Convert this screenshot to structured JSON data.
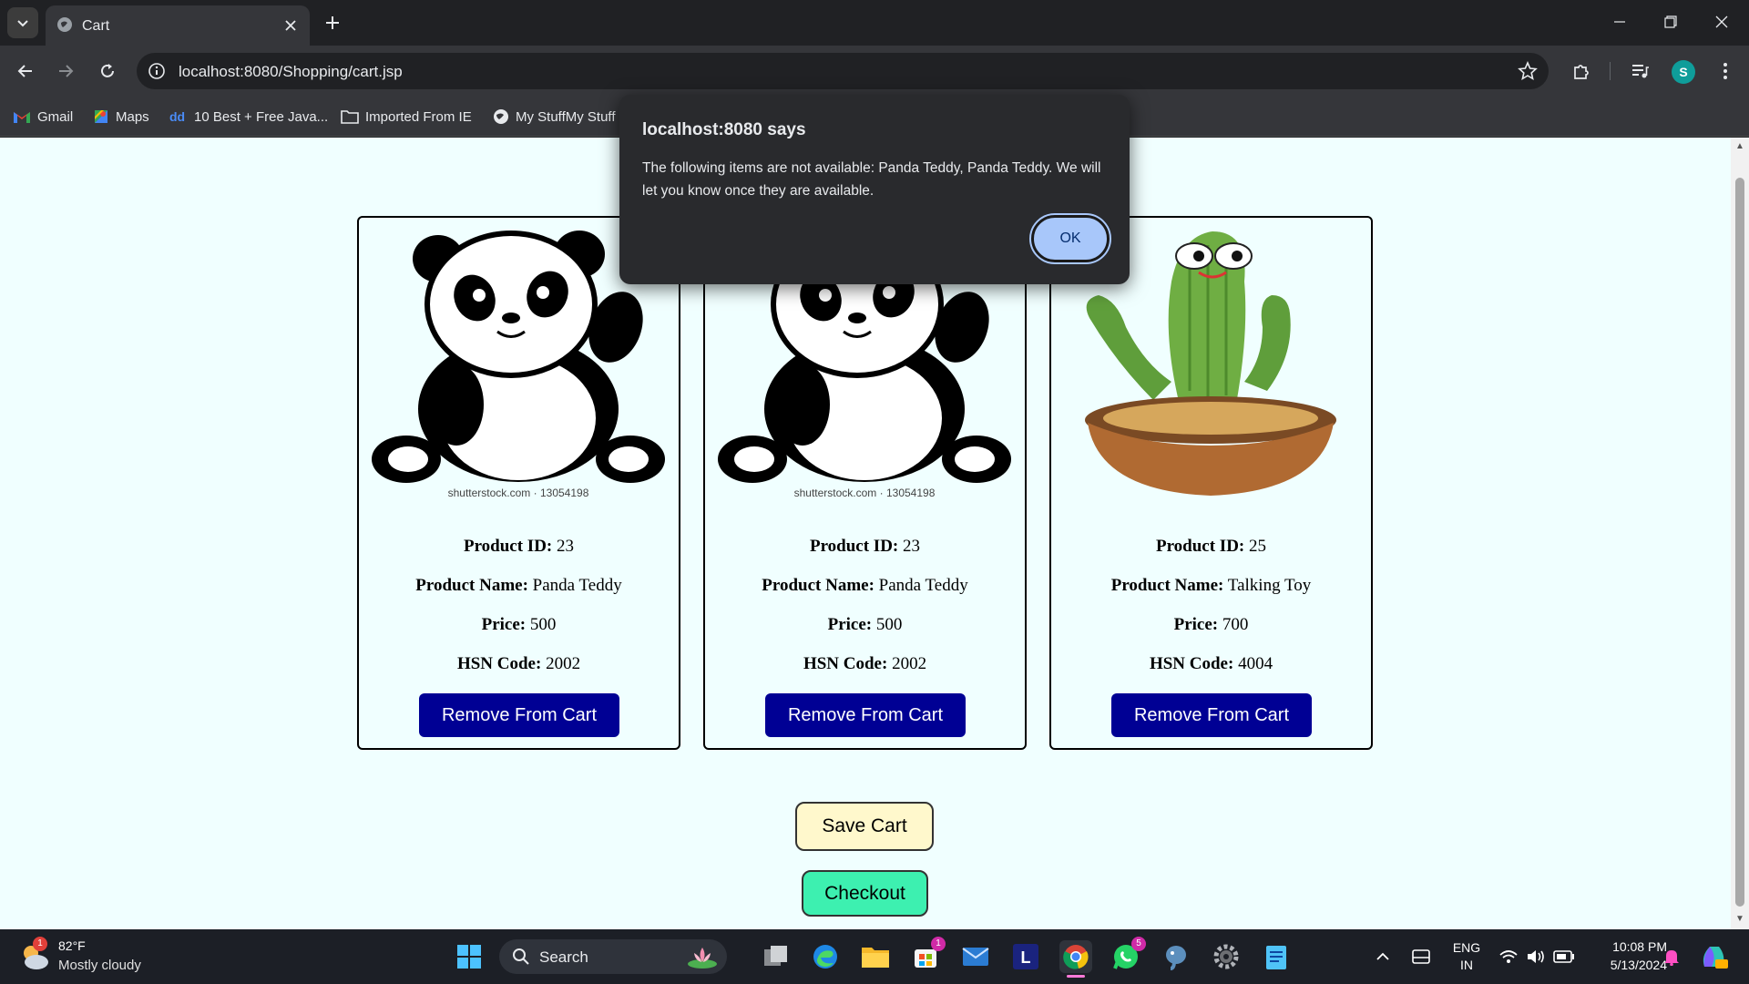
{
  "browser": {
    "tab_title": "Cart",
    "url": "localhost:8080/Shopping/cart.jsp",
    "profile_initial": "S",
    "bookmarks": [
      {
        "label": "Gmail",
        "icon": "gmail-icon"
      },
      {
        "label": "Maps",
        "icon": "maps-icon"
      },
      {
        "label": "10 Best + Free Java...",
        "icon": "dd-icon"
      },
      {
        "label": "Imported From IE",
        "icon": "folder-icon"
      },
      {
        "label": "My StuffMy Stuff",
        "icon": "globe-icon"
      }
    ]
  },
  "alert": {
    "title": "localhost:8080 says",
    "message": "The following items are not available: Panda Teddy, Panda Teddy. We will let you know once they are available.",
    "ok_label": "OK"
  },
  "cart": {
    "labels": {
      "id": "Product ID:",
      "name": "Product Name:",
      "price": "Price:",
      "hsn": "HSN Code:",
      "remove": "Remove From Cart"
    },
    "items": [
      {
        "id": "23",
        "name": "Panda Teddy",
        "price": "500",
        "hsn": "2002",
        "image": "panda-illustration",
        "image_caption": "shutterstock.com · 13054198"
      },
      {
        "id": "23",
        "name": "Panda Teddy",
        "price": "500",
        "hsn": "2002",
        "image": "panda-illustration",
        "image_caption": "shutterstock.com · 13054198"
      },
      {
        "id": "25",
        "name": "Talking Toy",
        "price": "700",
        "hsn": "4004",
        "image": "dancing-cactus-toy"
      }
    ],
    "save_label": "Save Cart",
    "checkout_label": "Checkout"
  },
  "taskbar": {
    "weather_temp": "82°F",
    "weather_desc": "Mostly cloudy",
    "weather_badge": "1",
    "search_label": "Search",
    "store_badge": "1",
    "whatsapp_badge": "5",
    "lang_line1": "ENG",
    "lang_line2": "IN",
    "time": "10:08 PM",
    "date": "5/13/2024"
  },
  "colors": {
    "page_bg": "#f0ffff",
    "remove_button": "#000094",
    "save_button": "#fff8cc",
    "checkout_button": "#3df0b0",
    "dialog_ok": "#a8c7fa"
  }
}
